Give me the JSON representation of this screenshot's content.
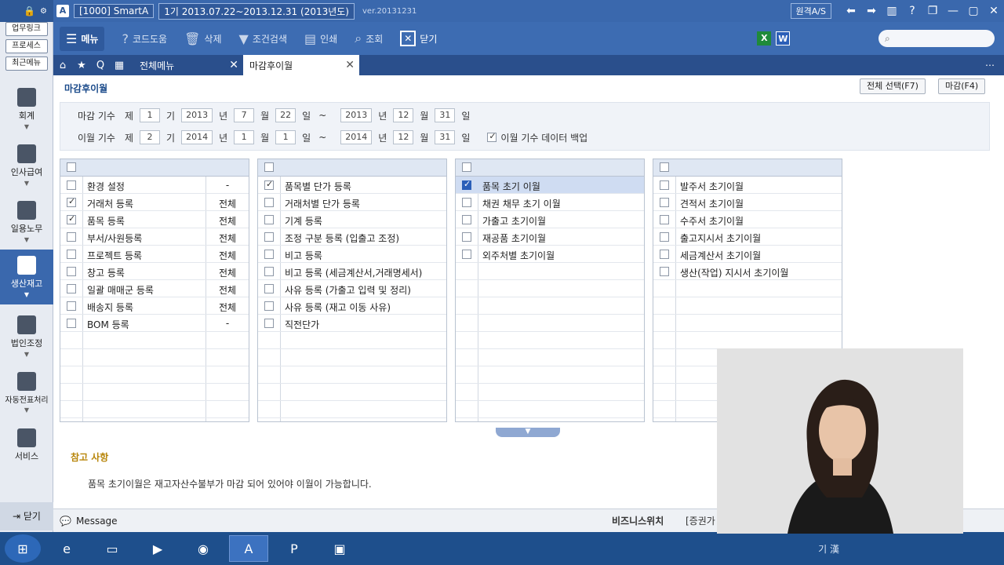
{
  "titlebar": {
    "app": "[1000] SmartA",
    "period": "1기 2013.07.22~2013.12.31 (2013년도)",
    "version": "ver.20131231",
    "remote_as": "원격A/S"
  },
  "sidebar": {
    "top_buttons": [
      "업무링크",
      "프로세스",
      "최근메뉴"
    ],
    "items": [
      {
        "label": "회계",
        "icon": "calculator-icon"
      },
      {
        "label": "인사급여",
        "icon": "people-icon"
      },
      {
        "label": "일용노무",
        "icon": "worker-icon"
      },
      {
        "label": "생산재고",
        "icon": "grid-icon"
      },
      {
        "label": "법인조정",
        "icon": "building-icon"
      },
      {
        "label": "자동전표처리",
        "icon": "database-icon"
      },
      {
        "label": "서비스",
        "icon": "monitor-icon"
      }
    ],
    "close": "닫기"
  },
  "toolbar": {
    "menu": "메뉴",
    "help": "코드도움",
    "delete": "삭제",
    "search_cond": "조건검색",
    "print": "인쇄",
    "query": "조회",
    "close": "닫기"
  },
  "tabs": {
    "all_menu": "전체메뉴",
    "current": "마감후이월"
  },
  "page": {
    "title": "마감후이월",
    "btn_select_all": "전체 선택(F7)",
    "btn_close": "마감(F4)"
  },
  "filter": {
    "row1": {
      "label": "마감 기수",
      "je": "제",
      "term": "1",
      "gi": "기",
      "from_year": "2013",
      "year": "년",
      "from_month": "7",
      "month": "월",
      "from_day": "22",
      "day": "일",
      "tilde": "~",
      "to_year": "2013",
      "to_month": "12",
      "to_day": "31"
    },
    "row2": {
      "label": "이월 기수",
      "je": "제",
      "term": "2",
      "gi": "기",
      "from_year": "2014",
      "year": "년",
      "from_month": "1",
      "month": "월",
      "from_day": "1",
      "day": "일",
      "tilde": "~",
      "to_year": "2014",
      "to_month": "12",
      "to_day": "31"
    },
    "backup_label": "이월 기수 데이터 백업"
  },
  "grid1": [
    {
      "label": "환경 설정",
      "val": "-",
      "checked": false
    },
    {
      "label": "거래처 등록",
      "val": "전체",
      "checked": true
    },
    {
      "label": "품목 등록",
      "val": "전체",
      "checked": true
    },
    {
      "label": "부서/사원등록",
      "val": "전체",
      "checked": false
    },
    {
      "label": "프로젝트 등록",
      "val": "전체",
      "checked": false
    },
    {
      "label": "창고 등록",
      "val": "전체",
      "checked": false
    },
    {
      "label": "일괄 매매군 등록",
      "val": "전체",
      "checked": false
    },
    {
      "label": "배송지 등록",
      "val": "전체",
      "checked": false
    },
    {
      "label": "BOM 등록",
      "val": "-",
      "checked": false
    }
  ],
  "grid2": [
    {
      "label": "품목별 단가 등록",
      "checked": true
    },
    {
      "label": "거래처별 단가 등록",
      "checked": false
    },
    {
      "label": "기계 등록",
      "checked": false
    },
    {
      "label": "조정 구분 등록 (입출고 조정)",
      "checked": false
    },
    {
      "label": "비고 등록",
      "checked": false
    },
    {
      "label": "비고 등록 (세금계산서,거래명세서)",
      "checked": false
    },
    {
      "label": "사유 등록 (가출고 입력 및 정리)",
      "checked": false
    },
    {
      "label": "사유 등록 (재고 이동 사유)",
      "checked": false
    },
    {
      "label": "직전단가",
      "checked": false
    }
  ],
  "grid3": [
    {
      "label": "품목 초기 이월",
      "checked": true
    },
    {
      "label": "채권 채무 초기 이월",
      "checked": false
    },
    {
      "label": "가출고 초기이월",
      "checked": false
    },
    {
      "label": "재공품 초기이월",
      "checked": false
    },
    {
      "label": "외주처별 초기이월",
      "checked": false
    }
  ],
  "grid4": [
    {
      "label": "발주서 초기이월",
      "checked": false
    },
    {
      "label": "견적서 초기이월",
      "checked": false
    },
    {
      "label": "수주서 초기이월",
      "checked": false
    },
    {
      "label": "출고지시서 초기이월",
      "checked": false
    },
    {
      "label": "세금계산서 초기이월",
      "checked": false
    },
    {
      "label": "생산(작업) 지시서 초기이월",
      "checked": false
    }
  ],
  "notes": {
    "title": "참고 사항",
    "text": "품목 초기이월은 재고자산수불부가 마감 되어 있어야 이월이 가능합니다."
  },
  "statusbar": {
    "message": "Message",
    "business_switch": "비즈니스위치",
    "extra": "[증권가"
  },
  "taskbar": {
    "tray_text": "기 漢"
  },
  "colors": {
    "titlebar": "#3a68ad",
    "toolbar": "#3d6cb2",
    "tabbar": "#2a4f8c",
    "sidebar_active": "#3a68ad",
    "taskbar": "#1e4f8c"
  }
}
